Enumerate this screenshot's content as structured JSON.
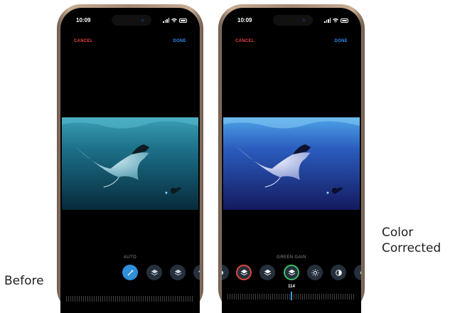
{
  "captions": {
    "before": "Before",
    "after": "Color Corrected"
  },
  "left_phone": {
    "status_time": "10:09",
    "cancel_label": "CANCEL",
    "done_label": "DONE",
    "tool_label": "AUTO",
    "tools": [
      "magic-wand-icon",
      "layers-icon",
      "layers-icon",
      "layers-icon"
    ],
    "active_tool": "magic-wand-icon"
  },
  "right_phone": {
    "status_time": "10:09",
    "cancel_label": "CANCEL",
    "done_label": "DONE",
    "tool_label": "GREEN GAIN",
    "tools": [
      "layers-icon",
      "layers-icon",
      "layers-icon",
      "layers-icon",
      "sun-icon",
      "contrast-icon",
      "partial-icon"
    ],
    "value": "114"
  },
  "colors": {
    "cancel": "#e8443a",
    "done": "#2b8cf5",
    "active_tool": "#2f8fd8",
    "red_ring": "#e2483b",
    "green_ring": "#3cc06a"
  }
}
